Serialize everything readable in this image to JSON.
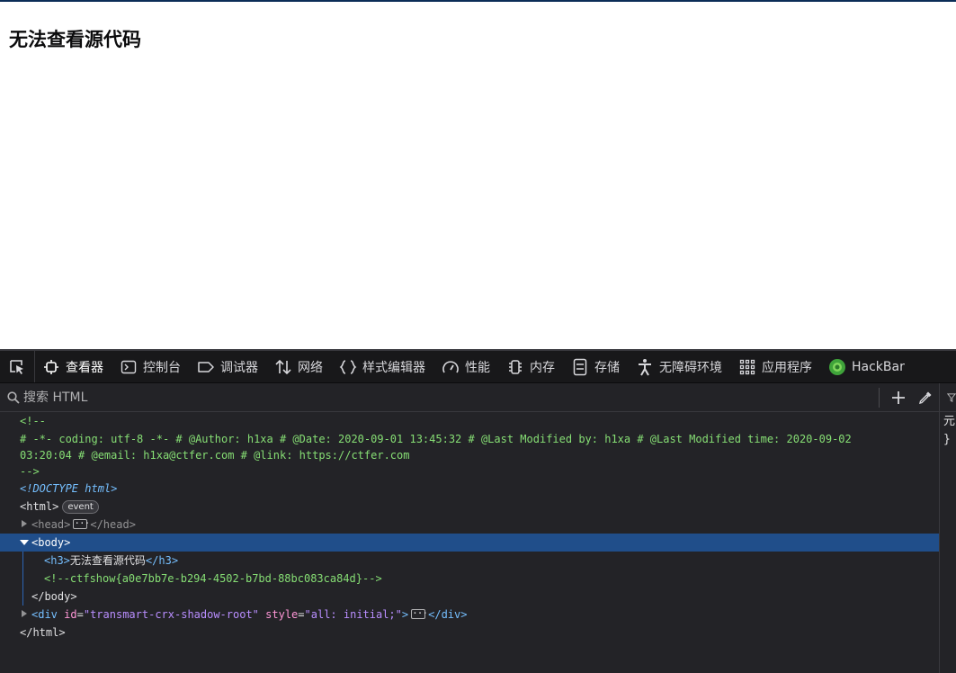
{
  "page": {
    "heading": "无法查看源代码"
  },
  "devtools": {
    "tabs": [
      {
        "label": "查看器",
        "icon": "inspector-icon",
        "active": true
      },
      {
        "label": "控制台",
        "icon": "console-icon"
      },
      {
        "label": "调试器",
        "icon": "debugger-icon"
      },
      {
        "label": "网络",
        "icon": "network-icon"
      },
      {
        "label": "样式编辑器",
        "icon": "style-editor-icon"
      },
      {
        "label": "性能",
        "icon": "performance-icon"
      },
      {
        "label": "内存",
        "icon": "memory-icon"
      },
      {
        "label": "存储",
        "icon": "storage-icon"
      },
      {
        "label": "无障碍环境",
        "icon": "accessibility-icon"
      },
      {
        "label": "应用程序",
        "icon": "application-icon"
      },
      {
        "label": "HackBar",
        "icon": "hackbar-icon"
      }
    ],
    "search_placeholder": "搜索 HTML",
    "side_panel_text": [
      "元",
      "}"
    ],
    "markup": {
      "comment_open": "<!--",
      "comment_body": "# -*- coding: utf-8 -*- # @Author: h1xa # @Date: 2020-09-01 13:45:32 # @Last Modified by: h1xa # @Last Modified time: 2020-09-02 03:20:04 # @email: h1xa@ctfer.com # @link: https://ctfer.com",
      "comment_close": "-->",
      "doctype": "<!DOCTYPE html>",
      "html_open": "<html>",
      "event_badge": "event",
      "head_open": "<head>",
      "head_close": "</head>",
      "body_open": "<body>",
      "h3_open": "<h3>",
      "h3_text": "无法查看源代码",
      "h3_close": "</h3>",
      "flag_comment": "<!--ctfshow{a0e7bb7e-b294-4502-b7bd-88bc083ca84d}-->",
      "body_close": "</body>",
      "div_open_lt": "<",
      "div_tag": "div",
      "div_attr1_name": "id",
      "div_attr1_value": "\"transmart-crx-shadow-root\"",
      "div_attr2_name": "style",
      "div_attr2_value": "\"all: initial;\"",
      "div_open_gt": ">",
      "div_close": "</div>",
      "html_close": "</html>",
      "eq": "="
    }
  },
  "colors": {
    "toolbar_bg": "#18181a",
    "panel_bg": "#232327",
    "selected_row": "#204e8a",
    "active_tab_accent": "#0a84ff",
    "comment": "#86de74",
    "tag": "#75bfff",
    "attribute": "#ff97d7",
    "attribute_value": "#b98eff"
  }
}
